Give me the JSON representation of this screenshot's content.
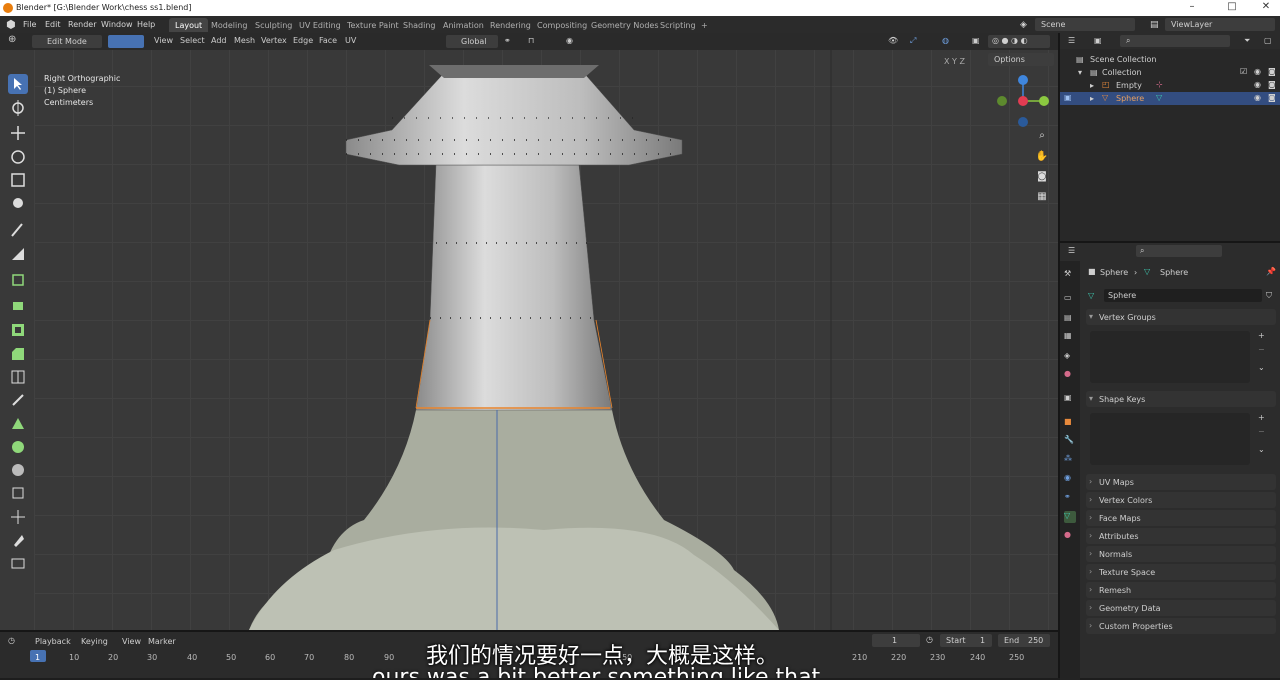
{
  "window": {
    "title": "Blender* [G:\\Blender Work\\chess ss1.blend]",
    "minimize": "–",
    "maximize": "□",
    "close": "✕"
  },
  "menu": {
    "items": [
      "File",
      "Edit",
      "Render",
      "Window",
      "Help"
    ]
  },
  "workspaces": [
    "Layout",
    "Modeling",
    "Sculpting",
    "UV Editing",
    "Texture Paint",
    "Shading",
    "Animation",
    "Rendering",
    "Compositing",
    "Geometry Nodes",
    "Scripting",
    "+"
  ],
  "scene": {
    "label": "Scene",
    "view_layer": "ViewLayer"
  },
  "header3d": {
    "mode": "Edit Mode",
    "menus": [
      "View",
      "Select",
      "Add",
      "Mesh",
      "Vertex",
      "Edge",
      "Face",
      "UV"
    ],
    "orientation": "Global",
    "options": "Options",
    "axes": [
      "X",
      "Y",
      "Z"
    ]
  },
  "viewport": {
    "view_name": "Right Orthographic",
    "object": "(1) Sphere",
    "units": "Centimeters"
  },
  "outliner": {
    "scene_collection": "Scene Collection",
    "collection": "Collection",
    "items": [
      "Empty",
      "Sphere"
    ]
  },
  "properties": {
    "breadcrumb_object": "Sphere",
    "breadcrumb_data": "Sphere",
    "mesh_name": "Sphere",
    "panels_open": [
      "Vertex Groups",
      "Shape Keys"
    ],
    "panels_closed": [
      "UV Maps",
      "Vertex Colors",
      "Face Maps",
      "Attributes",
      "Normals",
      "Texture Space",
      "Remesh",
      "Geometry Data",
      "Custom Properties"
    ]
  },
  "timeline": {
    "menus": [
      "Playback",
      "Keying",
      "View",
      "Marker"
    ],
    "current_frame": "1",
    "start_label": "Start",
    "start": "1",
    "end_label": "End",
    "end": "250",
    "ticks": [
      "1",
      "10",
      "20",
      "30",
      "40",
      "50",
      "60",
      "70",
      "80",
      "90",
      "150",
      "210",
      "220",
      "230",
      "240",
      "250"
    ]
  },
  "subtitles": {
    "zh": "我们的情况要好一点，大概是这样。",
    "en": "ours was a bit better something like that"
  },
  "colors": {
    "accent": "#4772b3",
    "selected_edge": "#e8842c",
    "x_axis": "#e23c52",
    "y_axis": "#8bc840",
    "z_axis": "#3f86dd"
  }
}
